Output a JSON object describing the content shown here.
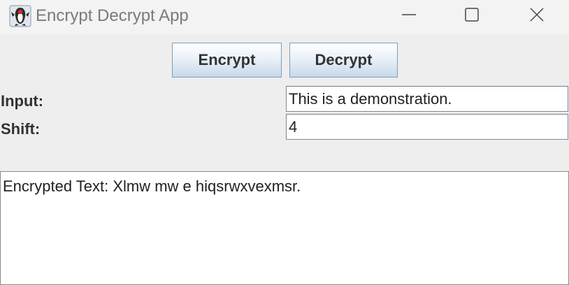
{
  "window": {
    "title": "Encrypt Decrypt App",
    "icon": "java-duke-icon",
    "controls": [
      "minimize-icon",
      "maximize-icon",
      "close-icon"
    ]
  },
  "buttons": {
    "encrypt_label": "Encrypt",
    "decrypt_label": "Decrypt"
  },
  "form": {
    "input_label": "Input:",
    "input_value": "This is a demonstration.",
    "shift_label": "Shift:",
    "shift_value": "4"
  },
  "output": {
    "text": "Encrypted Text: Xlmw mw e hiqsrwxvexmsr."
  },
  "colors": {
    "window_bg": "#eeeeee",
    "titlebar_bg": "#f3f3f3",
    "button_border": "#7f9db9",
    "text": "#333333"
  }
}
